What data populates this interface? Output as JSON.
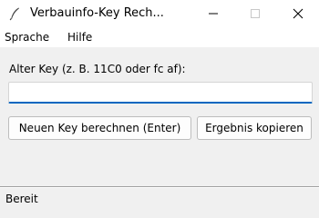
{
  "window": {
    "title": "Verbauinfo-Key Rech...",
    "controls": {
      "minimize_icon": "minimize-icon",
      "maximize_icon": "maximize-icon",
      "close_icon": "close-icon"
    },
    "app_icon": "feather-icon"
  },
  "menu": {
    "items": [
      {
        "label": "Sprache"
      },
      {
        "label": "Hilfe"
      }
    ]
  },
  "form": {
    "old_key_label": "Alter Key (z. B. 11C0 oder fc af):",
    "old_key_value": "",
    "compute_button": "Neuen Key berechnen (Enter)",
    "copy_button": "Ergebnis kopieren"
  },
  "status": {
    "text": "Bereit"
  },
  "colors": {
    "background": "#f0f0f0",
    "titlebar": "#ffffff",
    "input_focus": "#0067c0"
  }
}
